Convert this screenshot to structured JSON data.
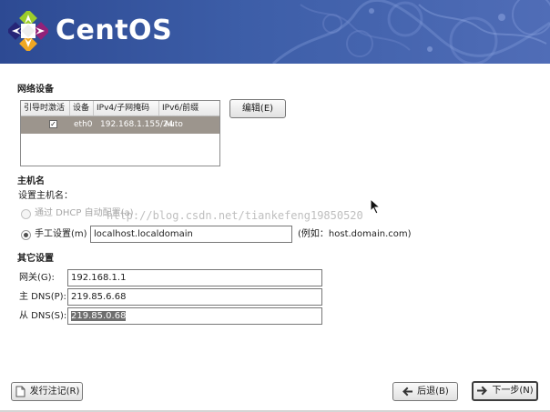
{
  "banner": {
    "brand_name": "CentOS",
    "logo_icon": "centos-logo-icon"
  },
  "network_devices": {
    "section_title": "网络设备",
    "columns": [
      "引导时激活",
      "设备",
      "IPv4/子网掩码",
      "IPv6/前缀"
    ],
    "rows": [
      {
        "activate_on_boot": true,
        "device": "eth0",
        "ipv4": "192.168.1.155/24",
        "ipv6": "Auto"
      }
    ],
    "edit_button": "编辑(E)"
  },
  "hostname": {
    "section_title": "主机名",
    "set_label": "设置主机名：",
    "dhcp_option": "通过 DHCP 自动配置(a)",
    "manual_option": "手工设置(m)",
    "manual_value": "localhost.localdomain",
    "example": "(例如：host.domain.com)"
  },
  "other_settings": {
    "section_title": "其它设置",
    "gateway_label": "网关(G):",
    "gateway_value": "192.168.1.1",
    "primary_dns_label": "主 DNS(P):",
    "primary_dns_value": "219.85.6.68",
    "secondary_dns_label": "从 DNS(S):",
    "secondary_dns_value": "219.85.0.68"
  },
  "watermark": "http://blog.csdn.net/tiankefeng19850520",
  "footer": {
    "release_notes_button": "发行注记(R)",
    "back_button": "后退(B)",
    "next_button": "下一步(N)"
  },
  "colors": {
    "banner": "#3d5ea8",
    "selected_row": "#9c958d"
  },
  "icons": {
    "release_notes": "document-icon",
    "back": "arrow-left-icon",
    "next": "arrow-right-icon",
    "checkbox": "checkbox-checked-icon"
  }
}
